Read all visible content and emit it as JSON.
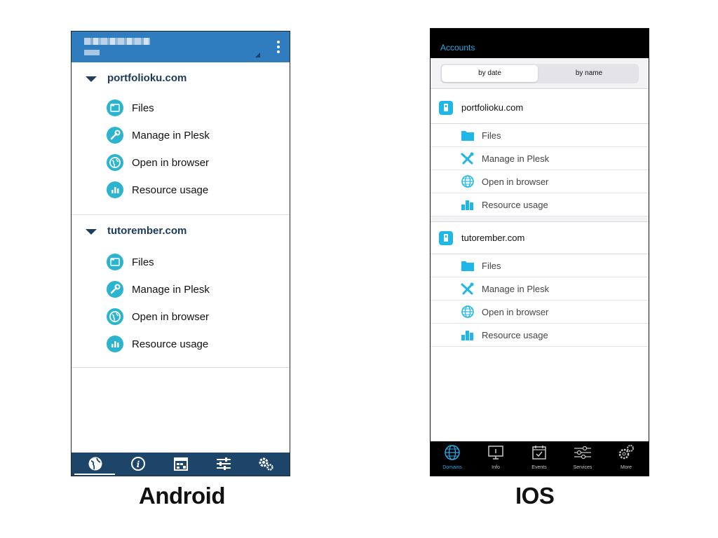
{
  "android": {
    "label": "Android",
    "domains": [
      {
        "name": "portfolioku.com",
        "items": [
          {
            "label": "Files",
            "icon": "folder-icon"
          },
          {
            "label": "Manage in Plesk",
            "icon": "wrench-icon"
          },
          {
            "label": "Open in browser",
            "icon": "globe-icon"
          },
          {
            "label": "Resource usage",
            "icon": "bar-chart-icon"
          }
        ]
      },
      {
        "name": "tutorember.com",
        "items": [
          {
            "label": "Files",
            "icon": "folder-icon"
          },
          {
            "label": "Manage in Plesk",
            "icon": "wrench-icon"
          },
          {
            "label": "Open in browser",
            "icon": "globe-icon"
          },
          {
            "label": "Resource usage",
            "icon": "bar-chart-icon"
          }
        ]
      }
    ],
    "bottom_nav": [
      "globe-icon",
      "info-icon",
      "calendar-icon",
      "sliders-icon",
      "gears-icon"
    ],
    "colors": {
      "header": "#2f7dbf",
      "nav": "#1c4569",
      "icon": "#2bb3d0",
      "domain_text": "#1b3a5b"
    }
  },
  "ios": {
    "label": "IOS",
    "title": "Accounts",
    "segments": {
      "by_date": "by date",
      "by_name": "by name",
      "selected": "by date"
    },
    "domains": [
      {
        "name": "portfolioku.com",
        "items": [
          {
            "label": "Files",
            "icon": "folder-icon"
          },
          {
            "label": "Manage in Plesk",
            "icon": "tools-icon"
          },
          {
            "label": "Open in browser",
            "icon": "globe-icon"
          },
          {
            "label": "Resource usage",
            "icon": "bar-chart-icon"
          }
        ]
      },
      {
        "name": "tutorember.com",
        "items": [
          {
            "label": "Files",
            "icon": "folder-icon"
          },
          {
            "label": "Manage in Plesk",
            "icon": "tools-icon"
          },
          {
            "label": "Open in browser",
            "icon": "globe-icon"
          },
          {
            "label": "Resource usage",
            "icon": "bar-chart-icon"
          }
        ]
      }
    ],
    "tabs": [
      {
        "label": "Domains",
        "icon": "globe-icon",
        "active": true
      },
      {
        "label": "Info",
        "icon": "monitor-icon",
        "active": false
      },
      {
        "label": "Events",
        "icon": "calendar-check-icon",
        "active": false
      },
      {
        "label": "Services",
        "icon": "sliders-icon",
        "active": false
      },
      {
        "label": "More",
        "icon": "gears-icon",
        "active": false
      }
    ],
    "colors": {
      "accent": "#2aa9e6",
      "icon": "#1eb7e8",
      "header": "#000000"
    }
  }
}
